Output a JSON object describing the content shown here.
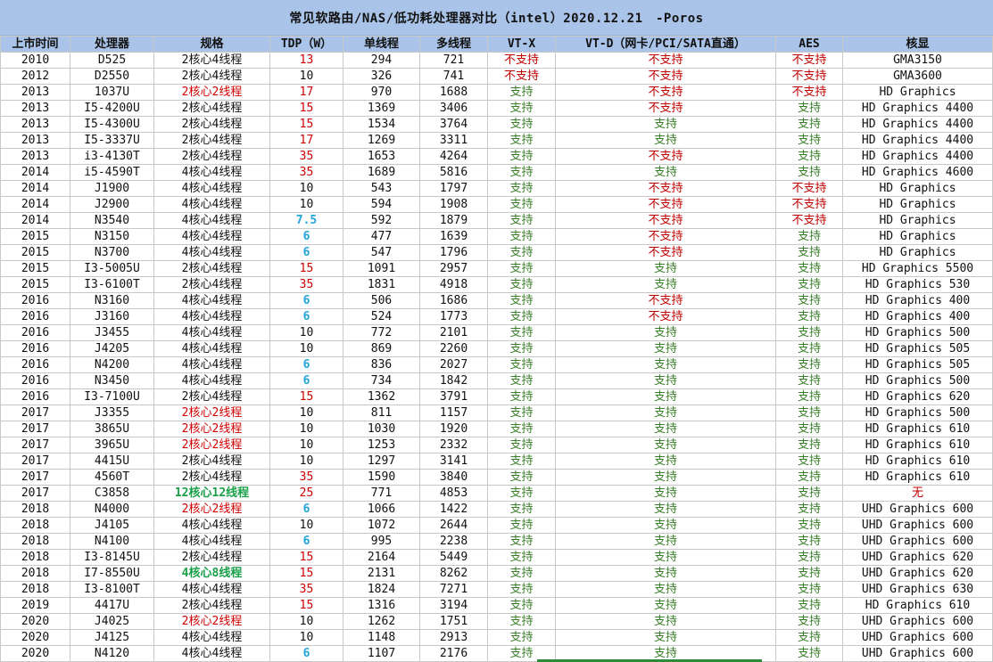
{
  "title": "常见软路由/NAS/低功耗处理器对比（intel）2020.12.21　-Poros",
  "headers": [
    "上市时间",
    "处理器",
    "规格",
    "TDP（W）",
    "单线程",
    "多线程",
    "VT-X",
    "VT-D（网卡/PCI/SATA直通）",
    "AES",
    "核显"
  ],
  "colors": {
    "header_bg": "#a9c4e8",
    "support": "#3a7d2a",
    "unsupported": "#c00000",
    "tdp_high": "#d00000",
    "tdp_low": "#22a4dc",
    "spec_highlight_red": "#d00000",
    "spec_highlight_green": "#1aa04a"
  },
  "rows": [
    {
      "year": "2010",
      "cpu": "D525",
      "spec": "2核心4线程",
      "spec_style": "black",
      "tdp": "13",
      "tdp_style": "red",
      "single": "294",
      "multi": "721",
      "vtx": "不支持",
      "vtd": "不支持",
      "aes": "不支持",
      "gpu": "GMA3150",
      "gpu_style": "black"
    },
    {
      "year": "2012",
      "cpu": "D2550",
      "spec": "2核心4线程",
      "spec_style": "black",
      "tdp": "10",
      "tdp_style": "black",
      "single": "326",
      "multi": "741",
      "vtx": "不支持",
      "vtd": "不支持",
      "aes": "不支持",
      "gpu": "GMA3600",
      "gpu_style": "black"
    },
    {
      "year": "2013",
      "cpu": "1037U",
      "spec": "2核心2线程",
      "spec_style": "red",
      "tdp": "17",
      "tdp_style": "red",
      "single": "970",
      "multi": "1688",
      "vtx": "支持",
      "vtd": "不支持",
      "aes": "不支持",
      "gpu": "HD Graphics",
      "gpu_style": "black"
    },
    {
      "year": "2013",
      "cpu": "I5-4200U",
      "spec": "2核心4线程",
      "spec_style": "black",
      "tdp": "15",
      "tdp_style": "red",
      "single": "1369",
      "multi": "3406",
      "vtx": "支持",
      "vtd": "不支持",
      "aes": "支持",
      "gpu": "HD Graphics 4400",
      "gpu_style": "black"
    },
    {
      "year": "2013",
      "cpu": "I5-4300U",
      "spec": "2核心4线程",
      "spec_style": "black",
      "tdp": "15",
      "tdp_style": "red",
      "single": "1534",
      "multi": "3764",
      "vtx": "支持",
      "vtd": "支持",
      "aes": "支持",
      "gpu": "HD Graphics 4400",
      "gpu_style": "black"
    },
    {
      "year": "2013",
      "cpu": "I5-3337U",
      "spec": "2核心4线程",
      "spec_style": "black",
      "tdp": "17",
      "tdp_style": "red",
      "single": "1269",
      "multi": "3311",
      "vtx": "支持",
      "vtd": "支持",
      "aes": "支持",
      "gpu": "HD Graphics 4400",
      "gpu_style": "black"
    },
    {
      "year": "2013",
      "cpu": "i3-4130T",
      "spec": "2核心4线程",
      "spec_style": "black",
      "tdp": "35",
      "tdp_style": "red",
      "single": "1653",
      "multi": "4264",
      "vtx": "支持",
      "vtd": "不支持",
      "aes": "支持",
      "gpu": "HD Graphics 4400",
      "gpu_style": "black"
    },
    {
      "year": "2014",
      "cpu": "i5-4590T",
      "spec": "4核心4线程",
      "spec_style": "black",
      "tdp": "35",
      "tdp_style": "red",
      "single": "1689",
      "multi": "5816",
      "vtx": "支持",
      "vtd": "支持",
      "aes": "支持",
      "gpu": "HD Graphics 4600",
      "gpu_style": "black"
    },
    {
      "year": "2014",
      "cpu": "J1900",
      "spec": "4核心4线程",
      "spec_style": "black",
      "tdp": "10",
      "tdp_style": "black",
      "single": "543",
      "multi": "1797",
      "vtx": "支持",
      "vtd": "不支持",
      "aes": "不支持",
      "gpu": "HD Graphics",
      "gpu_style": "black"
    },
    {
      "year": "2014",
      "cpu": "J2900",
      "spec": "4核心4线程",
      "spec_style": "black",
      "tdp": "10",
      "tdp_style": "black",
      "single": "594",
      "multi": "1908",
      "vtx": "支持",
      "vtd": "不支持",
      "aes": "不支持",
      "gpu": "HD Graphics",
      "gpu_style": "black"
    },
    {
      "year": "2014",
      "cpu": "N3540",
      "spec": "4核心4线程",
      "spec_style": "black",
      "tdp": "7.5",
      "tdp_style": "blue",
      "single": "592",
      "multi": "1879",
      "vtx": "支持",
      "vtd": "不支持",
      "aes": "不支持",
      "gpu": "HD Graphics",
      "gpu_style": "black"
    },
    {
      "year": "2015",
      "cpu": "N3150",
      "spec": "4核心4线程",
      "spec_style": "black",
      "tdp": "6",
      "tdp_style": "blue",
      "single": "477",
      "multi": "1639",
      "vtx": "支持",
      "vtd": "不支持",
      "aes": "支持",
      "gpu": "HD Graphics",
      "gpu_style": "black"
    },
    {
      "year": "2015",
      "cpu": "N3700",
      "spec": "4核心4线程",
      "spec_style": "black",
      "tdp": "6",
      "tdp_style": "blue",
      "single": "547",
      "multi": "1796",
      "vtx": "支持",
      "vtd": "不支持",
      "aes": "支持",
      "gpu": "HD Graphics",
      "gpu_style": "black"
    },
    {
      "year": "2015",
      "cpu": "I3-5005U",
      "spec": "2核心4线程",
      "spec_style": "black",
      "tdp": "15",
      "tdp_style": "red",
      "single": "1091",
      "multi": "2957",
      "vtx": "支持",
      "vtd": "支持",
      "aes": "支持",
      "gpu": "HD Graphics 5500",
      "gpu_style": "black"
    },
    {
      "year": "2015",
      "cpu": "I3-6100T",
      "spec": "2核心4线程",
      "spec_style": "black",
      "tdp": "35",
      "tdp_style": "red",
      "single": "1831",
      "multi": "4918",
      "vtx": "支持",
      "vtd": "支持",
      "aes": "支持",
      "gpu": "HD Graphics 530",
      "gpu_style": "black"
    },
    {
      "year": "2016",
      "cpu": "N3160",
      "spec": "4核心4线程",
      "spec_style": "black",
      "tdp": "6",
      "tdp_style": "blue",
      "single": "506",
      "multi": "1686",
      "vtx": "支持",
      "vtd": "不支持",
      "aes": "支持",
      "gpu": "HD Graphics 400",
      "gpu_style": "black"
    },
    {
      "year": "2016",
      "cpu": "J3160",
      "spec": "4核心4线程",
      "spec_style": "black",
      "tdp": "6",
      "tdp_style": "blue",
      "single": "524",
      "multi": "1773",
      "vtx": "支持",
      "vtd": "不支持",
      "aes": "支持",
      "gpu": "HD Graphics 400",
      "gpu_style": "black"
    },
    {
      "year": "2016",
      "cpu": "J3455",
      "spec": "4核心4线程",
      "spec_style": "black",
      "tdp": "10",
      "tdp_style": "black",
      "single": "772",
      "multi": "2101",
      "vtx": "支持",
      "vtd": "支持",
      "aes": "支持",
      "gpu": "HD Graphics 500",
      "gpu_style": "black"
    },
    {
      "year": "2016",
      "cpu": "J4205",
      "spec": "4核心4线程",
      "spec_style": "black",
      "tdp": "10",
      "tdp_style": "black",
      "single": "869",
      "multi": "2260",
      "vtx": "支持",
      "vtd": "支持",
      "aes": "支持",
      "gpu": "HD Graphics 505",
      "gpu_style": "black"
    },
    {
      "year": "2016",
      "cpu": "N4200",
      "spec": "4核心4线程",
      "spec_style": "black",
      "tdp": "6",
      "tdp_style": "blue",
      "single": "836",
      "multi": "2027",
      "vtx": "支持",
      "vtd": "支持",
      "aes": "支持",
      "gpu": "HD Graphics 505",
      "gpu_style": "black"
    },
    {
      "year": "2016",
      "cpu": "N3450",
      "spec": "4核心4线程",
      "spec_style": "black",
      "tdp": "6",
      "tdp_style": "blue",
      "single": "734",
      "multi": "1842",
      "vtx": "支持",
      "vtd": "支持",
      "aes": "支持",
      "gpu": "HD Graphics 500",
      "gpu_style": "black"
    },
    {
      "year": "2016",
      "cpu": "I3-7100U",
      "spec": "2核心4线程",
      "spec_style": "black",
      "tdp": "15",
      "tdp_style": "red",
      "single": "1362",
      "multi": "3791",
      "vtx": "支持",
      "vtd": "支持",
      "aes": "支持",
      "gpu": "HD Graphics 620",
      "gpu_style": "black"
    },
    {
      "year": "2017",
      "cpu": "J3355",
      "spec": "2核心2线程",
      "spec_style": "red",
      "tdp": "10",
      "tdp_style": "black",
      "single": "811",
      "multi": "1157",
      "vtx": "支持",
      "vtd": "支持",
      "aes": "支持",
      "gpu": "HD Graphics 500",
      "gpu_style": "black"
    },
    {
      "year": "2017",
      "cpu": "3865U",
      "spec": "2核心2线程",
      "spec_style": "red",
      "tdp": "10",
      "tdp_style": "black",
      "single": "1030",
      "multi": "1920",
      "vtx": "支持",
      "vtd": "支持",
      "aes": "支持",
      "gpu": "HD Graphics 610",
      "gpu_style": "black"
    },
    {
      "year": "2017",
      "cpu": "3965U",
      "spec": "2核心2线程",
      "spec_style": "red",
      "tdp": "10",
      "tdp_style": "black",
      "single": "1253",
      "multi": "2332",
      "vtx": "支持",
      "vtd": "支持",
      "aes": "支持",
      "gpu": "HD Graphics 610",
      "gpu_style": "black"
    },
    {
      "year": "2017",
      "cpu": "4415U",
      "spec": "2核心4线程",
      "spec_style": "black",
      "tdp": "10",
      "tdp_style": "black",
      "single": "1297",
      "multi": "3141",
      "vtx": "支持",
      "vtd": "支持",
      "aes": "支持",
      "gpu": "HD Graphics 610",
      "gpu_style": "black"
    },
    {
      "year": "2017",
      "cpu": "4560T",
      "spec": "2核心4线程",
      "spec_style": "black",
      "tdp": "35",
      "tdp_style": "red",
      "single": "1590",
      "multi": "3840",
      "vtx": "支持",
      "vtd": "支持",
      "aes": "支持",
      "gpu": "HD Graphics 610",
      "gpu_style": "black"
    },
    {
      "year": "2017",
      "cpu": "C3858",
      "spec": "12核心12线程",
      "spec_style": "green",
      "tdp": "25",
      "tdp_style": "red",
      "single": "771",
      "multi": "4853",
      "vtx": "支持",
      "vtd": "支持",
      "aes": "支持",
      "gpu": "无",
      "gpu_style": "red"
    },
    {
      "year": "2018",
      "cpu": "N4000",
      "spec": "2核心2线程",
      "spec_style": "red",
      "tdp": "6",
      "tdp_style": "blue",
      "single": "1066",
      "multi": "1422",
      "vtx": "支持",
      "vtd": "支持",
      "aes": "支持",
      "gpu": "UHD Graphics 600",
      "gpu_style": "black"
    },
    {
      "year": "2018",
      "cpu": "J4105",
      "spec": "4核心4线程",
      "spec_style": "black",
      "tdp": "10",
      "tdp_style": "black",
      "single": "1072",
      "multi": "2644",
      "vtx": "支持",
      "vtd": "支持",
      "aes": "支持",
      "gpu": "UHD Graphics 600",
      "gpu_style": "black"
    },
    {
      "year": "2018",
      "cpu": "N4100",
      "spec": "4核心4线程",
      "spec_style": "black",
      "tdp": "6",
      "tdp_style": "blue",
      "single": "995",
      "multi": "2238",
      "vtx": "支持",
      "vtd": "支持",
      "aes": "支持",
      "gpu": "UHD Graphics 600",
      "gpu_style": "black"
    },
    {
      "year": "2018",
      "cpu": "I3-8145U",
      "spec": "2核心4线程",
      "spec_style": "black",
      "tdp": "15",
      "tdp_style": "red",
      "single": "2164",
      "multi": "5449",
      "vtx": "支持",
      "vtd": "支持",
      "aes": "支持",
      "gpu": "UHD Graphics 620",
      "gpu_style": "black"
    },
    {
      "year": "2018",
      "cpu": "I7-8550U",
      "spec": "4核心8线程",
      "spec_style": "green",
      "tdp": "15",
      "tdp_style": "red",
      "single": "2131",
      "multi": "8262",
      "vtx": "支持",
      "vtd": "支持",
      "aes": "支持",
      "gpu": "UHD Graphics 620",
      "gpu_style": "black"
    },
    {
      "year": "2018",
      "cpu": "I3-8100T",
      "spec": "4核心4线程",
      "spec_style": "black",
      "tdp": "35",
      "tdp_style": "red",
      "single": "1824",
      "multi": "7271",
      "vtx": "支持",
      "vtd": "支持",
      "aes": "支持",
      "gpu": "UHD Graphics 630",
      "gpu_style": "black"
    },
    {
      "year": "2019",
      "cpu": "4417U",
      "spec": "2核心4线程",
      "spec_style": "black",
      "tdp": "15",
      "tdp_style": "red",
      "single": "1316",
      "multi": "3194",
      "vtx": "支持",
      "vtd": "支持",
      "aes": "支持",
      "gpu": "HD Graphics 610",
      "gpu_style": "black"
    },
    {
      "year": "2020",
      "cpu": "J4025",
      "spec": "2核心2线程",
      "spec_style": "red",
      "tdp": "10",
      "tdp_style": "black",
      "single": "1262",
      "multi": "1751",
      "vtx": "支持",
      "vtd": "支持",
      "aes": "支持",
      "gpu": "UHD Graphics 600",
      "gpu_style": "black"
    },
    {
      "year": "2020",
      "cpu": "J4125",
      "spec": "4核心4线程",
      "spec_style": "black",
      "tdp": "10",
      "tdp_style": "black",
      "single": "1148",
      "multi": "2913",
      "vtx": "支持",
      "vtd": "支持",
      "aes": "支持",
      "gpu": "UHD Graphics 600",
      "gpu_style": "black"
    },
    {
      "year": "2020",
      "cpu": "N4120",
      "spec": "4核心4线程",
      "spec_style": "black",
      "tdp": "6",
      "tdp_style": "blue",
      "single": "1107",
      "multi": "2176",
      "vtx": "支持",
      "vtd": "支持",
      "aes": "支持",
      "gpu": "UHD Graphics 600",
      "gpu_style": "black"
    }
  ]
}
